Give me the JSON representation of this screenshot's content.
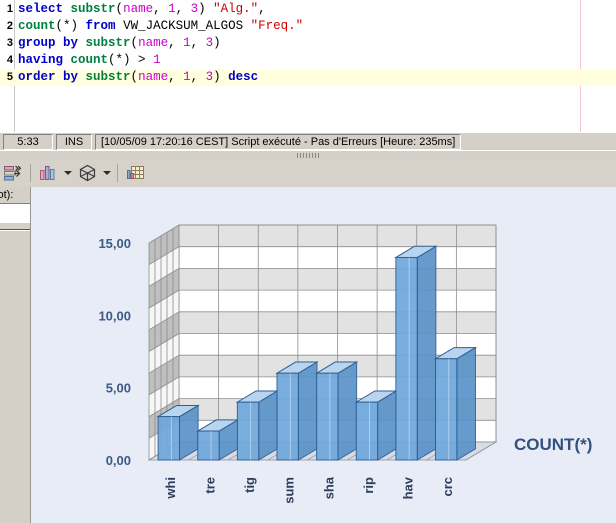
{
  "editor": {
    "lines": [
      {
        "n": "1",
        "tokens": [
          {
            "t": "select",
            "c": "kw"
          },
          {
            "t": " ",
            "c": "pl"
          },
          {
            "t": "substr",
            "c": "fn"
          },
          {
            "t": "(",
            "c": "pl"
          },
          {
            "t": "name",
            "c": "id"
          },
          {
            "t": ", ",
            "c": "pl"
          },
          {
            "t": "1",
            "c": "num"
          },
          {
            "t": ", ",
            "c": "pl"
          },
          {
            "t": "3",
            "c": "num"
          },
          {
            "t": ") ",
            "c": "pl"
          },
          {
            "t": "\"Alg.\"",
            "c": "str"
          },
          {
            "t": ",",
            "c": "pl"
          }
        ]
      },
      {
        "n": "2",
        "tokens": [
          {
            "t": "count",
            "c": "fn"
          },
          {
            "t": "(*) ",
            "c": "pl"
          },
          {
            "t": "from",
            "c": "kw"
          },
          {
            "t": " ",
            "c": "pl"
          },
          {
            "t": "VW_JACKSUM_ALGOS",
            "c": "pl"
          },
          {
            "t": " ",
            "c": "pl"
          },
          {
            "t": "\"Freq.\"",
            "c": "str"
          }
        ]
      },
      {
        "n": "3",
        "tokens": [
          {
            "t": "group by",
            "c": "kw"
          },
          {
            "t": " ",
            "c": "pl"
          },
          {
            "t": "substr",
            "c": "fn"
          },
          {
            "t": "(",
            "c": "pl"
          },
          {
            "t": "name",
            "c": "id"
          },
          {
            "t": ", ",
            "c": "pl"
          },
          {
            "t": "1",
            "c": "num"
          },
          {
            "t": ", ",
            "c": "pl"
          },
          {
            "t": "3",
            "c": "num"
          },
          {
            "t": ")",
            "c": "pl"
          }
        ]
      },
      {
        "n": "4",
        "tokens": [
          {
            "t": "having",
            "c": "kw"
          },
          {
            "t": " ",
            "c": "pl"
          },
          {
            "t": "count",
            "c": "fn"
          },
          {
            "t": "(*) > ",
            "c": "pl"
          },
          {
            "t": "1",
            "c": "num"
          }
        ]
      },
      {
        "n": "5",
        "highlight": true,
        "tokens": [
          {
            "t": "order by",
            "c": "kw"
          },
          {
            "t": " ",
            "c": "pl"
          },
          {
            "t": "substr",
            "c": "fn"
          },
          {
            "t": "(",
            "c": "pl"
          },
          {
            "t": "name",
            "c": "id"
          },
          {
            "t": ", ",
            "c": "pl"
          },
          {
            "t": "1",
            "c": "num"
          },
          {
            "t": ", ",
            "c": "pl"
          },
          {
            "t": "3",
            "c": "num"
          },
          {
            "t": ") ",
            "c": "pl"
          },
          {
            "t": "desc",
            "c": "kw"
          }
        ]
      }
    ]
  },
  "statusbar": {
    "cursor_position": "5:33",
    "insert_mode": "INS",
    "message": "[10/05/09 17:20:16 CEST] Script exécuté - Pas d'Erreurs [Heure: 235ms]"
  },
  "toolbar": {
    "export_data_label": "export-data",
    "chart_label": "bar-chart",
    "chart_dropdown_label": "chart-type-dropdown",
    "shape_label": "3d-shape",
    "shape_dropdown_label": "3d-shape-dropdown",
    "grid_label": "result-grid"
  },
  "left_panel": {
    "truncated_label": "vot):"
  },
  "chart_data": {
    "type": "bar",
    "title": "",
    "xlabel": "",
    "ylabel": "",
    "categories": [
      "whi",
      "tre",
      "tig",
      "sum",
      "sha",
      "rip",
      "hav",
      "crc"
    ],
    "values": [
      3,
      2,
      4,
      6,
      6,
      4,
      14,
      7
    ],
    "series": [
      {
        "name": "COUNT(*)",
        "values": [
          3,
          2,
          4,
          6,
          6,
          4,
          14,
          7
        ]
      }
    ],
    "legend_text": "COUNT(*)",
    "legend_position": "right",
    "ylim": [
      0,
      15
    ],
    "yticks": [
      "0,00",
      "5,00",
      "10,00",
      "15,00"
    ],
    "ytick_values": [
      0,
      5,
      10,
      15
    ],
    "grid": true,
    "three_d": true,
    "colors": {
      "bar_face": "#6fa8dc",
      "bar_top": "#b8d4ee",
      "bar_side": "#5b93c9",
      "bar_edge": "#2f5f93",
      "background": "#e8ecf7",
      "wall_light": "#ffffff",
      "wall_dark": "#e2e2e2",
      "side_wall_light": "#f6f6f6",
      "side_wall_dark": "#bfbfbf",
      "floor": "#d8dce8",
      "gridline": "#8d8d8d",
      "text": "#3c5a84"
    }
  }
}
